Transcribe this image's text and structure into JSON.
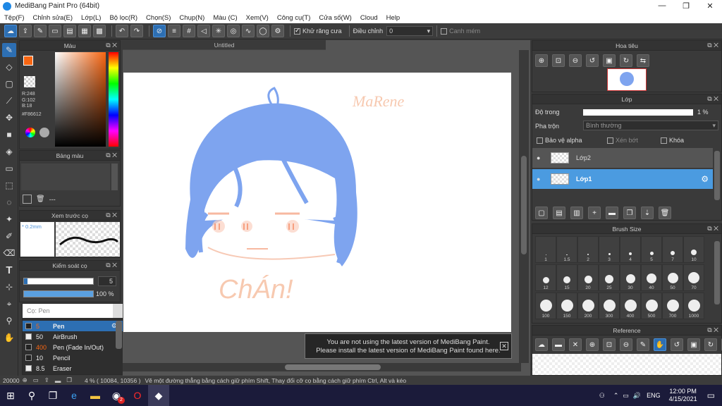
{
  "window": {
    "title": "MediBang Paint Pro (64bit)",
    "controls": [
      "—",
      "❐",
      "✕"
    ]
  },
  "menu": [
    "Tệp(F)",
    "Chỉnh sửa(E)",
    "Lớp(L)",
    "Bộ lọc(R)",
    "Chọn(S)",
    "Chụp(N)",
    "Màu (C)",
    "Xem(V)",
    "Công cụ(T)",
    "Cửa số(W)",
    "Cloud",
    "Help"
  ],
  "toolbar": {
    "antialias_label": "Khử răng cưa",
    "adjust_label": "Điều chỉnh",
    "adjust_value": "0",
    "guide_label": "Canh mém"
  },
  "color_panel": {
    "title": "Màu",
    "r": "R:248",
    "g": "G:102",
    "b": "B:18",
    "hex": "#F86612",
    "primary": "#f86612"
  },
  "palette_panel": {
    "title": "Bảng màu",
    "dash": "---"
  },
  "brush_preview": {
    "title": "Xem trước cọ",
    "size": "* 0.2mm"
  },
  "brush_control": {
    "title": "Kiểm soát cọ",
    "size": "5",
    "opacity": "100 %"
  },
  "brush_list": {
    "title": "Cọ: Pen",
    "items": [
      {
        "size": "5",
        "name": "Pen",
        "selected": true,
        "color": "#222"
      },
      {
        "size": "50",
        "name": "AirBrush",
        "selected": false,
        "color": "#eee"
      },
      {
        "size": "400",
        "name": "Pen (Fade In/Out)",
        "selected": false,
        "color": "#222"
      },
      {
        "size": "10",
        "name": "Pencil",
        "selected": false,
        "color": "#222"
      },
      {
        "size": "8.5",
        "name": "Eraser",
        "selected": false,
        "color": "#eee"
      }
    ]
  },
  "canvas": {
    "tab": "Untitled"
  },
  "notice": {
    "line1": "You are not using the latest version of MediBang Paint.",
    "line2": "Please install the latest version of MediBang Paint found here."
  },
  "navigator": {
    "title": "Hoa tiêu"
  },
  "layers": {
    "title": "Lớp",
    "opacity_label": "Độ trong",
    "opacity_value": "1 %",
    "blend_label": "Pha trộn",
    "blend_value": "Bình thường",
    "protect_alpha": "Bảo vệ alpha",
    "clipping": "Xén bớt",
    "lock": "Khóa",
    "items": [
      {
        "name": "Lớp2",
        "selected": false
      },
      {
        "name": "Lớp1",
        "selected": true
      }
    ]
  },
  "brush_size": {
    "title": "Brush Size",
    "sizes": [
      "1",
      "1.5",
      "2",
      "3",
      "4",
      "5",
      "7",
      "10",
      "12",
      "15",
      "20",
      "25",
      "30",
      "40",
      "50",
      "70",
      "100",
      "150",
      "200",
      "300",
      "400",
      "500",
      "700",
      "1000"
    ]
  },
  "reference": {
    "title": "Reference"
  },
  "status": {
    "coords": "20000",
    "zoom": "4 % ( 10084, 10356 )",
    "hint": "Vẽ một đường thẳng bằng cách giữ phím Shift, Thay đổi cỡ cọ bằng cách giữ phím Ctrl, Alt và kéo"
  },
  "taskbar": {
    "time": "12:00 PM",
    "date": "4/15/2021",
    "lang": "ENG",
    "badge": "2"
  }
}
